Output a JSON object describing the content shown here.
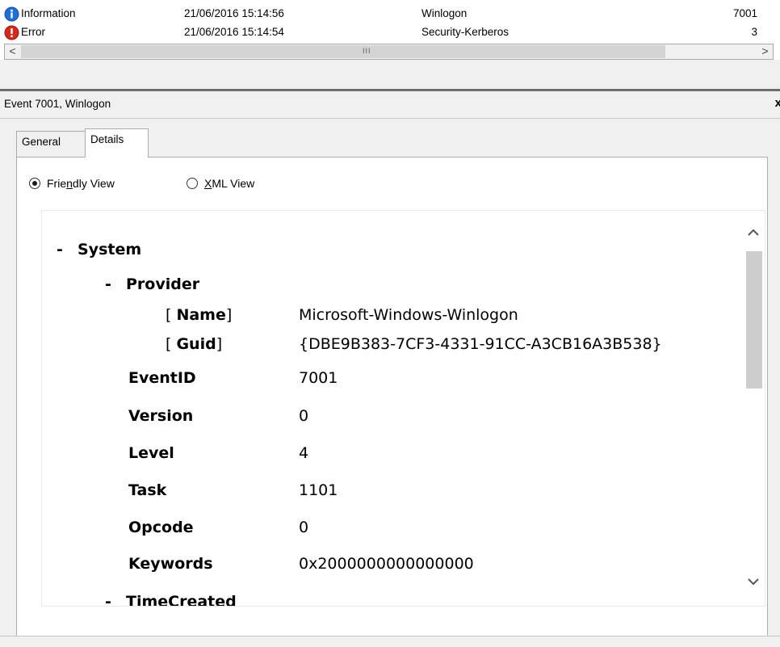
{
  "event_list": {
    "rows": [
      {
        "level": "Information",
        "date": "21/06/2016 15:14:56",
        "source": "Winlogon",
        "event_id": "7001",
        "icon": "information-icon"
      },
      {
        "level": "Error",
        "date": "21/06/2016 15:14:54",
        "source": "Security-Kerberos",
        "event_id": "3",
        "icon": "error-icon"
      }
    ],
    "scrollbar": {
      "left_arrow": "<",
      "right_arrow": ">",
      "grip": "III"
    }
  },
  "details_pane": {
    "title": "Event 7001, Winlogon",
    "close_glyph": "x",
    "tabs": [
      {
        "label": "General"
      },
      {
        "label": "Details"
      }
    ],
    "active_tab": "Details",
    "view_options": {
      "friendly": {
        "before": "Frie",
        "accel": "n",
        "after": "dly View"
      },
      "xml": {
        "before": "",
        "accel": "X",
        "after": "ML View"
      },
      "selected": "friendly"
    }
  },
  "event_xml": {
    "system": {
      "toggle": "-",
      "label": "System"
    },
    "provider": {
      "toggle": "-",
      "label": "Provider"
    },
    "provider_attrs": [
      {
        "name": "Name",
        "value": "Microsoft-Windows-Winlogon"
      },
      {
        "name": "Guid",
        "value": "{DBE9B383-7CF3-4331-91CC-A3CB16A3B538}"
      }
    ],
    "fields": [
      {
        "name": "EventID",
        "value": "7001"
      },
      {
        "name": "Version",
        "value": "0"
      },
      {
        "name": "Level",
        "value": "4"
      },
      {
        "name": "Task",
        "value": "1101"
      },
      {
        "name": "Opcode",
        "value": "0"
      },
      {
        "name": "Keywords",
        "value": "0x2000000000000000"
      }
    ],
    "time_created": {
      "toggle": "-",
      "label": "TimeCreated"
    }
  },
  "colors": {
    "info_blue": "#1f6fd6",
    "error_red": "#d42a1e",
    "panel_bg": "#f0f0f0"
  }
}
